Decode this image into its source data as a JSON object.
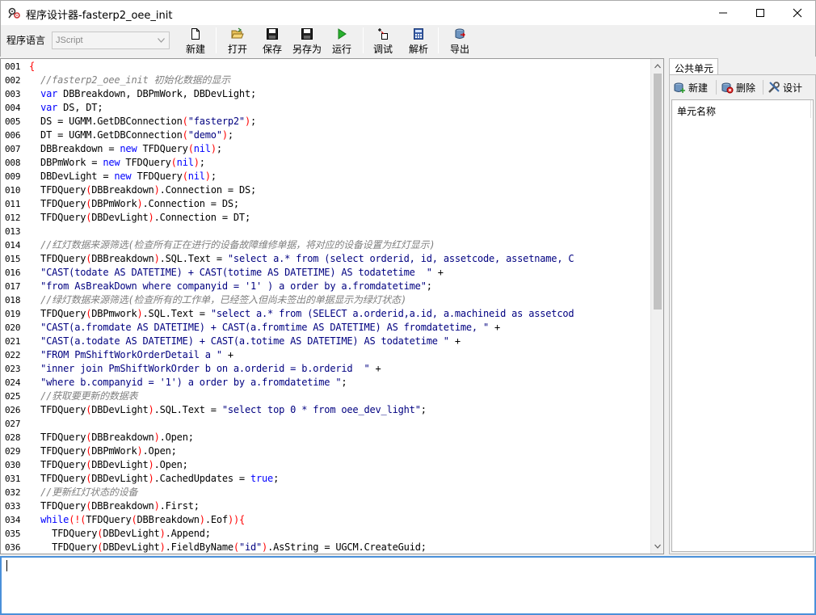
{
  "window": {
    "title": "程序设计器-fasterp2_oee_init",
    "icon": "app-gear-icon"
  },
  "toolbar": {
    "lang_label": "程序语言",
    "lang_value": "JScript",
    "buttons": [
      {
        "label": "新建",
        "icon": "new-file-icon"
      },
      {
        "label": "打开",
        "icon": "folder-open-icon"
      },
      {
        "label": "保存",
        "icon": "floppy-icon"
      },
      {
        "label": "另存为",
        "icon": "floppy-saveas-icon"
      },
      {
        "label": "运行",
        "icon": "play-icon"
      },
      {
        "label": "调试",
        "icon": "debug-icon"
      },
      {
        "label": "解析",
        "icon": "calculator-icon"
      },
      {
        "label": "导出",
        "icon": "export-icon"
      }
    ]
  },
  "editor": {
    "lines": [
      {
        "n": "001",
        "t": "{"
      },
      {
        "n": "002",
        "t": "  //fasterp2_oee_init 初始化数据的显示"
      },
      {
        "n": "003",
        "t": "  var DBBreakdown, DBPmWork, DBDevLight;"
      },
      {
        "n": "004",
        "t": "  var DS, DT;"
      },
      {
        "n": "005",
        "t": "  DS = UGMM.GetDBConnection(\"fasterp2\");"
      },
      {
        "n": "006",
        "t": "  DT = UGMM.GetDBConnection(\"demo\");"
      },
      {
        "n": "007",
        "t": "  DBBreakdown = new TFDQuery(nil);"
      },
      {
        "n": "008",
        "t": "  DBPmWork = new TFDQuery(nil);"
      },
      {
        "n": "009",
        "t": "  DBDevLight = new TFDQuery(nil);"
      },
      {
        "n": "010",
        "t": "  TFDQuery(DBBreakdown).Connection = DS;"
      },
      {
        "n": "011",
        "t": "  TFDQuery(DBPmWork).Connection = DS;"
      },
      {
        "n": "012",
        "t": "  TFDQuery(DBDevLight).Connection = DT;"
      },
      {
        "n": "013",
        "t": ""
      },
      {
        "n": "014",
        "t": "  //红灯数据来源筛选(检查所有正在进行的设备故障维修单据，将对应的设备设置为红灯显示)"
      },
      {
        "n": "015",
        "t": "  TFDQuery(DBBreakdown).SQL.Text = \"select a.* from (select orderid, id, assetcode, assetname, C"
      },
      {
        "n": "016",
        "t": "  \"CAST(todate AS DATETIME) + CAST(totime AS DATETIME) AS todatetime  \" +"
      },
      {
        "n": "017",
        "t": "  \"from AsBreakDown where companyid = '1' ) a order by a.fromdatetime\";"
      },
      {
        "n": "018",
        "t": "  //绿灯数据来源筛选(检查所有的工作单，已经签入但尚未签出的单据显示为绿灯状态)"
      },
      {
        "n": "019",
        "t": "  TFDQuery(DBPmwork).SQL.Text = \"select a.* from (SELECT a.orderid,a.id, a.machineid as assetcod"
      },
      {
        "n": "020",
        "t": "  \"CAST(a.fromdate AS DATETIME) + CAST(a.fromtime AS DATETIME) AS fromdatetime, \" +"
      },
      {
        "n": "021",
        "t": "  \"CAST(a.todate AS DATETIME) + CAST(a.totime AS DATETIME) AS todatetime \" +"
      },
      {
        "n": "022",
        "t": "  \"FROM PmShiftWorkOrderDetail a \" +"
      },
      {
        "n": "023",
        "t": "  \"inner join PmShiftWorkOrder b on a.orderid = b.orderid  \" +"
      },
      {
        "n": "024",
        "t": "  \"where b.companyid = '1') a order by a.fromdatetime \";"
      },
      {
        "n": "025",
        "t": "  //获取要更新的数据表"
      },
      {
        "n": "026",
        "t": "  TFDQuery(DBDevLight).SQL.Text = \"select top 0 * from oee_dev_light\";"
      },
      {
        "n": "027",
        "t": ""
      },
      {
        "n": "028",
        "t": "  TFDQuery(DBBreakdown).Open;"
      },
      {
        "n": "029",
        "t": "  TFDQuery(DBPmWork).Open;"
      },
      {
        "n": "030",
        "t": "  TFDQuery(DBDevLight).Open;"
      },
      {
        "n": "031",
        "t": "  TFDQuery(DBDevLight).CachedUpdates = true;"
      },
      {
        "n": "032",
        "t": "  //更新红灯状态的设备"
      },
      {
        "n": "033",
        "t": "  TFDQuery(DBBreakdown).First;"
      },
      {
        "n": "034",
        "t": "  while(!(TFDQuery(DBBreakdown).Eof)){"
      },
      {
        "n": "035",
        "t": "    TFDQuery(DBDevLight).Append;"
      },
      {
        "n": "036",
        "t": "    TFDQuery(DBDevLight).FieldByName(\"id\").AsString = UGCM.CreateGuid;"
      }
    ]
  },
  "public_units": {
    "tab_label": "公共单元",
    "buttons": [
      {
        "label": "新建",
        "icon": "new-unit-icon"
      },
      {
        "label": "删除",
        "icon": "delete-icon"
      },
      {
        "label": "设计",
        "icon": "tools-icon"
      }
    ],
    "column_header": "单元名称"
  },
  "output": {
    "text": ""
  }
}
